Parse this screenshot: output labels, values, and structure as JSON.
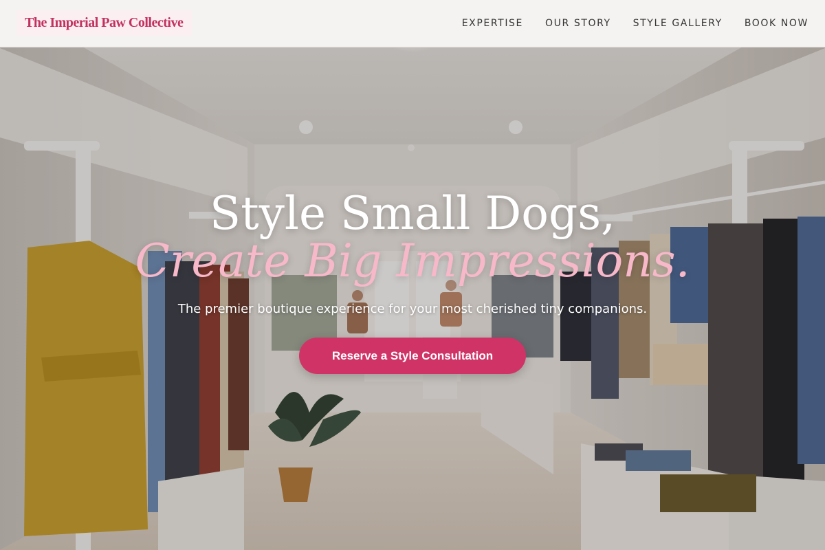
{
  "brand": {
    "name": "The Imperial Paw Collective"
  },
  "nav": {
    "items": [
      {
        "label": "EXPERTISE"
      },
      {
        "label": "OUR STORY"
      },
      {
        "label": "STYLE GALLERY"
      },
      {
        "label": "BOOK NOW"
      }
    ]
  },
  "hero": {
    "headline_line1": "Style Small Dogs,",
    "headline_line2": "Create Big Impressions.",
    "subtitle": "The premier boutique experience for your most cherished tiny companions.",
    "cta_label": "Reserve a Style Consultation"
  },
  "colors": {
    "brand_pink": "#c2315f",
    "accent_pink": "#f7b8c9",
    "cta_pink": "#d03467"
  }
}
